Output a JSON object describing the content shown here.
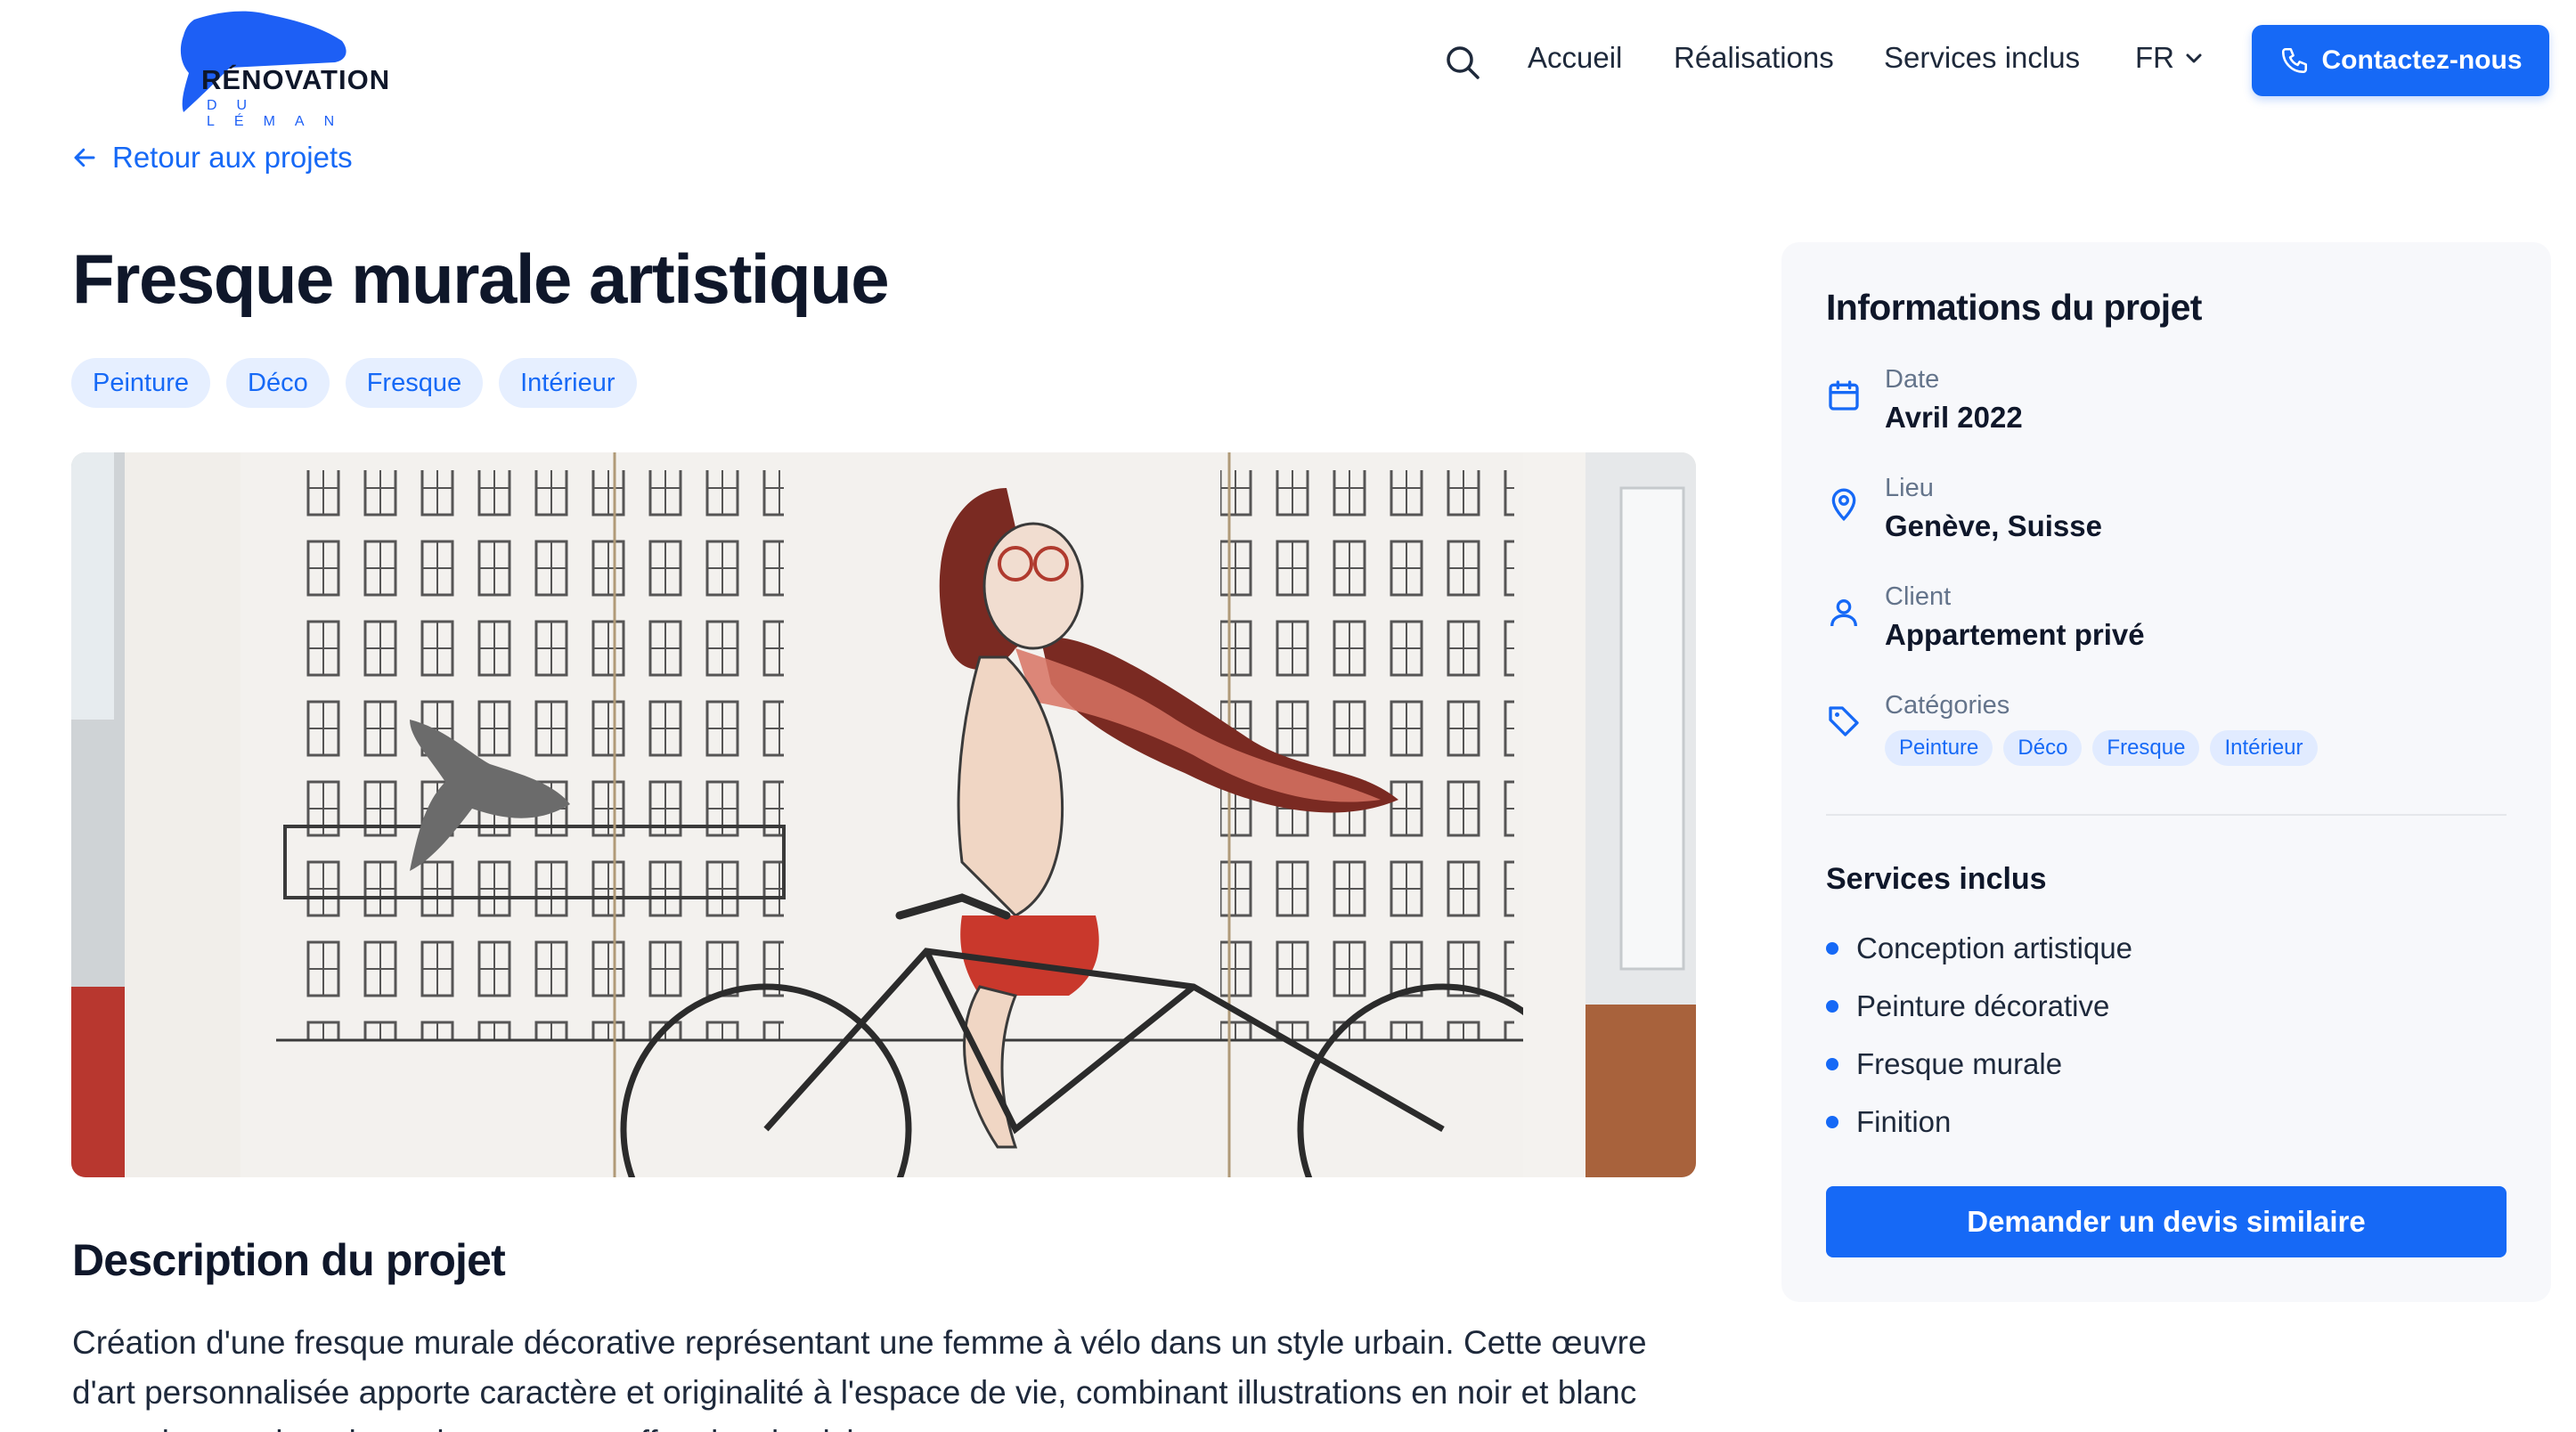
{
  "brand": {
    "name": "RÉNOVATION",
    "sub": "DU LÉMAN",
    "color": "#1d5ff5"
  },
  "nav": {
    "search_icon": "search-icon",
    "links": [
      "Accueil",
      "Réalisations",
      "Services inclus"
    ],
    "lang": "FR",
    "cta": "Contactez-nous"
  },
  "back_link": "Retour aux projets",
  "project": {
    "title": "Fresque murale artistique",
    "tags": [
      "Peinture",
      "Déco",
      "Fresque",
      "Intérieur"
    ]
  },
  "description": {
    "heading": "Description du projet",
    "text": "Création d'une fresque murale décorative représentant une femme à vélo dans un style urbain. Cette œuvre d'art personnalisée apporte caractère et originalité à l'espace de vie, combinant illustrations en noir et blanc avec des touches de couleur pour un effet visuel saisissant."
  },
  "sidebar": {
    "heading": "Informations du projet",
    "date": {
      "label": "Date",
      "value": "Avril 2022",
      "icon": "calendar-icon"
    },
    "location": {
      "label": "Lieu",
      "value": "Genève, Suisse",
      "icon": "map-pin-icon"
    },
    "client": {
      "label": "Client",
      "value": "Appartement privé",
      "icon": "user-icon"
    },
    "categories": {
      "label": "Catégories",
      "values": [
        "Peinture",
        "Déco",
        "Fresque",
        "Intérieur"
      ],
      "icon": "tag-icon"
    },
    "services_heading": "Services inclus",
    "services": [
      "Conception artistique",
      "Peinture décorative",
      "Fresque murale",
      "Finition"
    ],
    "quote_button": "Demander un devis similaire"
  },
  "colors": {
    "accent": "#1669f6",
    "tag_bg": "#e6efff",
    "text": "#0f172a",
    "muted": "#64748b"
  }
}
